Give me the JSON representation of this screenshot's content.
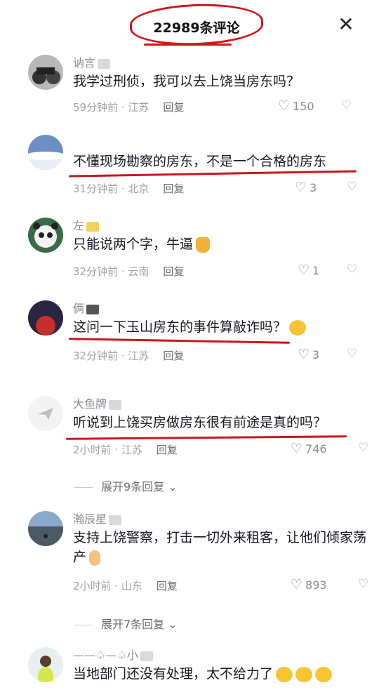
{
  "header": {
    "title": "22989条评论",
    "close_icon": "close-icon"
  },
  "comments": [
    {
      "name": "讷言",
      "text": "我学过刑侦，我可以去上饶当房东吗？",
      "time": "59分钟前 · 江苏",
      "reply": "回复",
      "likes": "150"
    },
    {
      "name": "",
      "text": "不懂现场勘察的房东，不是一个合格的房东",
      "time": "31分钟前 · 北京",
      "reply": "回复",
      "likes": "3"
    },
    {
      "name": "左",
      "text": "只能说两个字，牛逼",
      "time": "32分钟前 · 云南",
      "reply": "回复",
      "likes": "1"
    },
    {
      "name": "俩",
      "text": "这问一下玉山房东的事件算敲诈吗？",
      "time": "32分钟前 · 江苏",
      "reply": "回复",
      "likes": "3"
    },
    {
      "name": "大鱼牌",
      "text": "听说到上饶买房做房东很有前途是真的吗？",
      "time": "2小时前 · 江苏",
      "reply": "回复",
      "likes": "746"
    },
    {
      "name": "瀚辰星",
      "text": "支持上饶警察，打击一切外来租客，让他们倾家荡产",
      "time": "2小时前 · 山东",
      "reply": "回复",
      "likes": "893"
    },
    {
      "name": "——♤—♤小",
      "text": "当地部门还没有处理，太不给力了",
      "time": "",
      "reply": "",
      "likes": ""
    }
  ],
  "expand": [
    {
      "label": "展开9条回复"
    },
    {
      "label": "展开7条回复"
    }
  ],
  "colors": {
    "annotation_red": "#c8181b",
    "meta_gray": "#a1a2a7"
  }
}
